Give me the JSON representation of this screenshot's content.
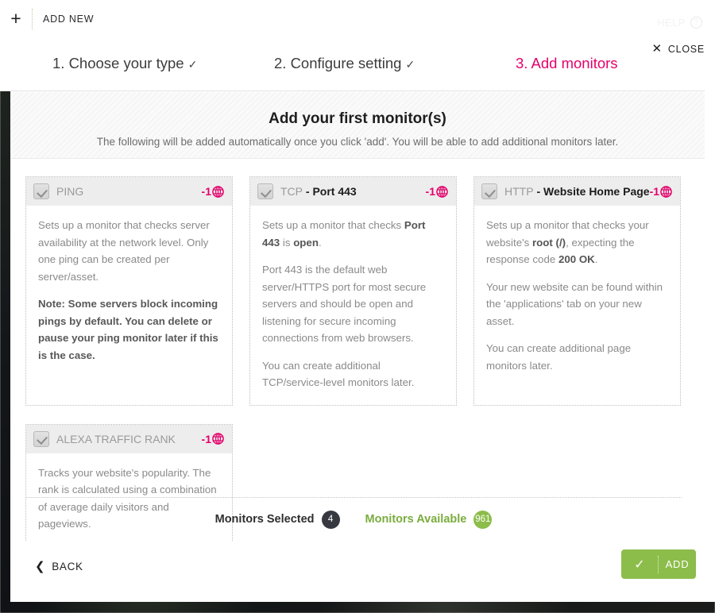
{
  "window": {
    "add_new_tab_label": "ADD NEW",
    "plus_icon": "plus-icon",
    "help_label": "HELP",
    "close_label": "CLOSE"
  },
  "steps": [
    {
      "label": "1. Choose your type",
      "tick": "✓",
      "state": "complete"
    },
    {
      "label": "2. Configure setting",
      "tick": "✓",
      "state": "complete"
    },
    {
      "label": "3. Add monitors",
      "tick": "",
      "state": "active"
    }
  ],
  "banner": {
    "title": "Add your first monitor(s)",
    "subtitle": "The following will be added automatically once you click 'add'. You will be able to add additional monitors later."
  },
  "cards": [
    {
      "name_plain": "PING",
      "name_strong": "",
      "badge": "-1",
      "checked": true,
      "paragraphs": [
        {
          "html": "Sets up a monitor that checks server availability at the network level. Only one ping can be created per server/asset.",
          "style": "normal"
        },
        {
          "html": "Note: Some servers block incoming pings by default. You can delete or pause your ping monitor later if this is the case.",
          "style": "note"
        }
      ]
    },
    {
      "name_plain": "TCP",
      "name_strong": " - Port 443",
      "badge": "-1",
      "checked": true,
      "paragraphs": [
        {
          "html": "Sets up a monitor that checks <b>Port 443</b> is <b>open</b>.",
          "style": "normal"
        },
        {
          "html": "Port 443 is the default web server/HTTPS port for most secure servers and should be open and listening for secure incoming connections from web browsers.",
          "style": "normal"
        },
        {
          "html": "You can create additional TCP/service-level monitors later.",
          "style": "normal"
        }
      ]
    },
    {
      "name_plain": "HTTP",
      "name_strong": " - Website Home Page",
      "badge": "-1",
      "checked": true,
      "paragraphs": [
        {
          "html": "Sets up a monitor that checks your website's <b>root (/)</b>, expecting the response code <b>200 OK</b>.",
          "style": "normal"
        },
        {
          "html": "Your new website can be found within the 'applications' tab on your new asset.",
          "style": "normal"
        },
        {
          "html": "You can create additional page monitors later.",
          "style": "normal"
        }
      ]
    },
    {
      "name_plain": "ALEXA TRAFFIC RANK",
      "name_strong": "",
      "badge": "-1",
      "checked": true,
      "paragraphs": [
        {
          "html": "Tracks your website's popularity. The rank is calculated using a combination of average daily visitors and pageviews.",
          "style": "normal"
        }
      ]
    }
  ],
  "counters": {
    "selected_label": "Monitors Selected",
    "selected_value": "4",
    "available_label": "Monitors Available",
    "available_value": "961"
  },
  "footer": {
    "back_label": "BACK",
    "add_label": "ADD"
  },
  "colors": {
    "accent_pink": "#e4006b",
    "accent_green": "#8cbd4a",
    "badge_dark": "#36393f"
  }
}
